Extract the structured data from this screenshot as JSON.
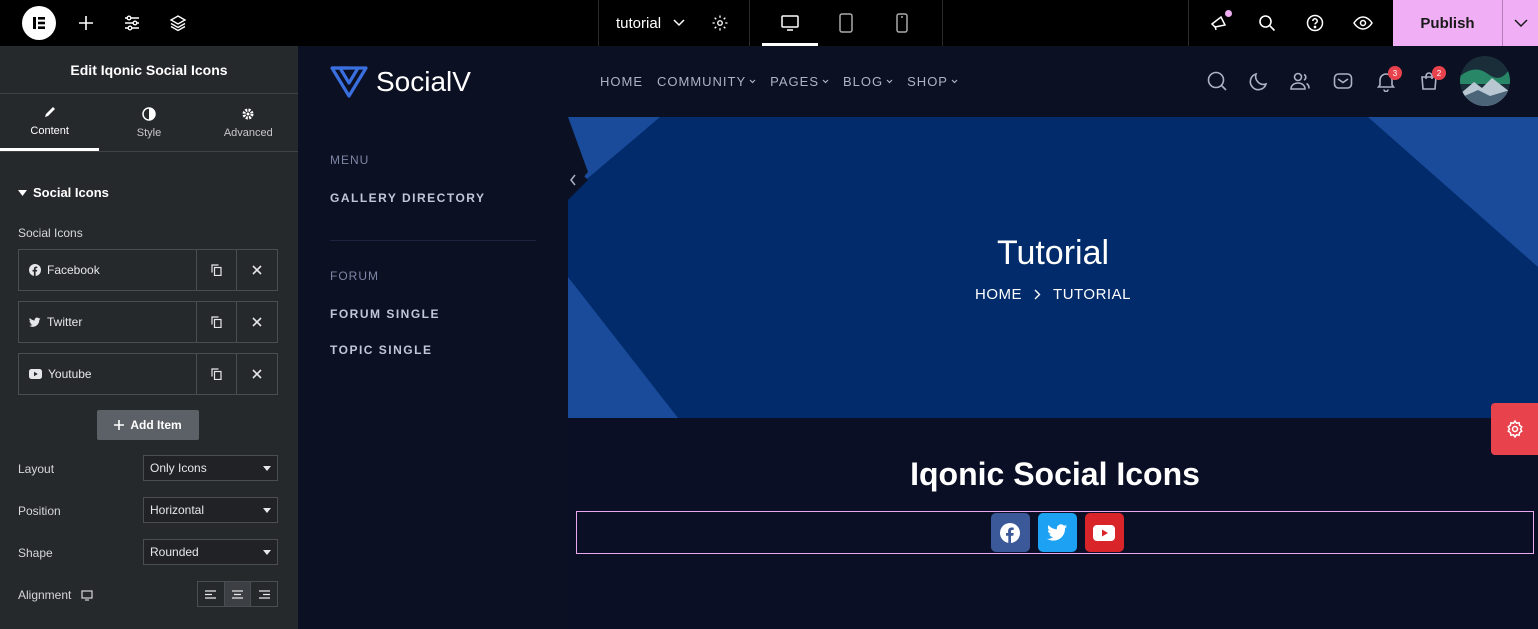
{
  "editor": {
    "doc_name": "tutorial",
    "publish_label": "Publish"
  },
  "panel": {
    "title": "Edit Iqonic Social Icons",
    "tabs": [
      {
        "label": "Content"
      },
      {
        "label": "Style"
      },
      {
        "label": "Advanced"
      }
    ],
    "section_title": "Social Icons",
    "field_label": "Social Icons",
    "items": [
      {
        "label": "Facebook"
      },
      {
        "label": "Twitter"
      },
      {
        "label": "Youtube"
      }
    ],
    "add_item_label": "Add Item",
    "controls": {
      "layout": {
        "label": "Layout",
        "value": "Only Icons"
      },
      "position": {
        "label": "Position",
        "value": "Horizontal"
      },
      "shape": {
        "label": "Shape",
        "value": "Rounded"
      },
      "alignment": {
        "label": "Alignment",
        "selected": "center"
      }
    }
  },
  "site": {
    "brand": "SocialV",
    "nav": [
      {
        "label": "HOME",
        "dropdown": false
      },
      {
        "label": "COMMUNITY",
        "dropdown": true
      },
      {
        "label": "PAGES",
        "dropdown": true
      },
      {
        "label": "BLOG",
        "dropdown": true
      },
      {
        "label": "SHOP",
        "dropdown": true
      }
    ],
    "notifications_count": "3",
    "cart_count": "2",
    "sidebar": {
      "head1": "MENU",
      "item1": "GALLERY DIRECTORY",
      "head2": "FORUM",
      "item2": "FORUM SINGLE",
      "item3": "TOPIC SINGLE"
    },
    "hero": {
      "title": "Tutorial",
      "breadcrumb_home": "HOME",
      "breadcrumb_current": "TUTORIAL"
    },
    "section_title": "Iqonic Social Icons",
    "socials": [
      {
        "icon": "facebook-icon",
        "color": "#3b5998"
      },
      {
        "icon": "twitter-icon",
        "color": "#1da1f2"
      },
      {
        "icon": "youtube-icon",
        "color": "#d9252a"
      }
    ]
  },
  "colors": {
    "publish": "#f0aef5",
    "hero_bg": "#022b6b",
    "accent_red": "#e8424d"
  }
}
